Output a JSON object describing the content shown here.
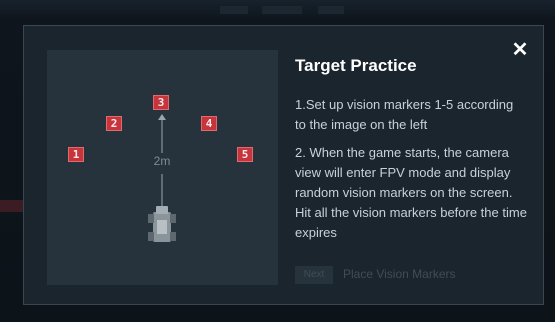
{
  "modal": {
    "title": "Target Practice",
    "close_icon": "close-icon",
    "steps": [
      "1.Set up vision markers 1-5 according to the image on the left",
      "2. When the game starts, the camera view will enter FPV mode and display random vision markers on the screen. Hit all the vision markers before the time expires"
    ],
    "next_button_label": "Next",
    "next_section_label": "Place Vision Markers"
  },
  "diagram": {
    "markers": [
      "1",
      "2",
      "3",
      "4",
      "5"
    ],
    "distance_label": "2m",
    "robot_icon": "robot-icon",
    "marker_color": "#c5353b"
  },
  "colors": {
    "modal_background": "#1a252e",
    "diagram_background": "#26333d",
    "text_primary": "#ffffff",
    "text_secondary": "#c9d1d7"
  }
}
